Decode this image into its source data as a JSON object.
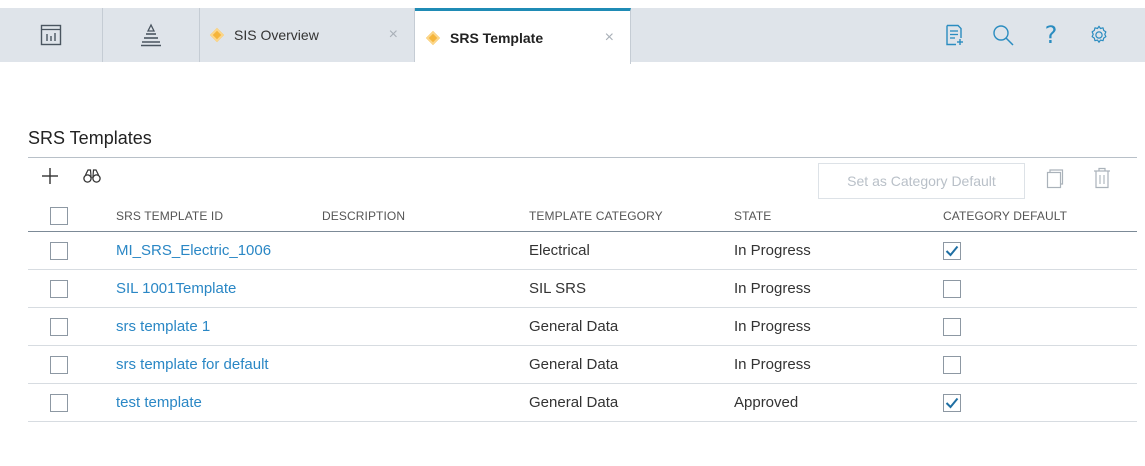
{
  "topbar": {
    "tabs": [
      {
        "label": "SIS Overview",
        "close": "×"
      },
      {
        "label": "SRS Template",
        "close": "×"
      }
    ],
    "icons": [
      "dashboard-icon",
      "asset-hierarchy-icon",
      "new-record-icon",
      "search-icon",
      "help-icon",
      "settings-icon"
    ],
    "help_glyph": "?"
  },
  "page": {
    "title": "SRS Templates"
  },
  "toolbar": {
    "set_default_label": "Set as Category Default",
    "icons": [
      "add-icon",
      "find-icon",
      "copy-icon",
      "delete-icon"
    ]
  },
  "table": {
    "columns": [
      "SRS TEMPLATE ID",
      "DESCRIPTION",
      "TEMPLATE CATEGORY",
      "STATE",
      "CATEGORY DEFAULT"
    ],
    "rows": [
      {
        "id": "MI_SRS_Electric_1006",
        "description": "",
        "category": "Electrical",
        "state": "In Progress",
        "category_default": true
      },
      {
        "id": "SIL 1001Template",
        "description": "",
        "category": "SIL SRS",
        "state": "In Progress",
        "category_default": false
      },
      {
        "id": "srs template 1",
        "description": "",
        "category": "General Data",
        "state": "In Progress",
        "category_default": false
      },
      {
        "id": "srs template for default",
        "description": "",
        "category": "General Data",
        "state": "In Progress",
        "category_default": false
      },
      {
        "id": "test template",
        "description": "",
        "category": "General Data",
        "state": "Approved",
        "category_default": true
      }
    ]
  },
  "colors": {
    "accent": "#1f8bb5",
    "link": "#2a87c5",
    "tab_icon": "#f5b53b",
    "topbar_bg": "#dfe4ea",
    "icon_blue": "#2a8cc0"
  }
}
